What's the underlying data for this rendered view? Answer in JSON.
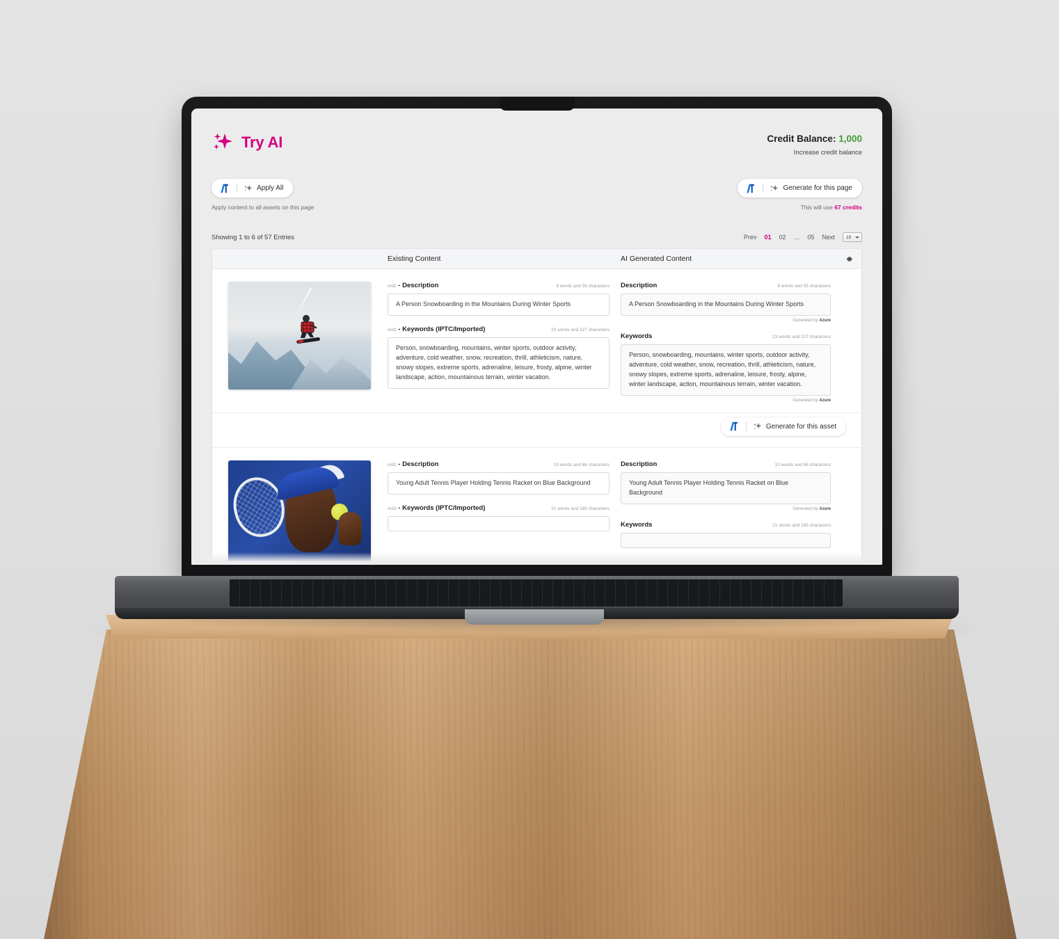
{
  "brand": {
    "title": "Try AI",
    "icon": "sparkle-icon"
  },
  "credit": {
    "label": "Credit Balance:",
    "value": "1,000",
    "link": "Increase credit balance",
    "value_color": "#3f9c35"
  },
  "actions": {
    "apply_all": {
      "label": "Apply All",
      "hint": "Apply content to all assets on this page"
    },
    "generate_page": {
      "label": "Generate for this page",
      "hint_prefix": "This will use ",
      "hint_credits": "67 credits",
      "credits_color": "#d4007f"
    }
  },
  "table_bar": {
    "showing": "Showing 1 to 6 of 57 Entries",
    "pager": {
      "prev": "Prev",
      "pages": [
        "01",
        "02",
        "…",
        "05"
      ],
      "active": "01",
      "next": "Next",
      "per_page": "10"
    }
  },
  "table_header": {
    "existing": "Existing Content",
    "ai": "AI Generated Content",
    "settings_icon": "gear-icon"
  },
  "row_action": {
    "label": "Generate for this asset"
  },
  "generated_note": {
    "prefix": "Generated by ",
    "source": "Azure"
  },
  "rows": [
    {
      "image_alt": "snowboarder-jumping",
      "existing": {
        "description": {
          "namespace": "md2",
          "label": "Description",
          "count": "8 words and 55 characters",
          "value": "A Person Snowboarding in the Mountains During Winter Sports"
        },
        "keywords": {
          "namespace": "md3",
          "label": "Keywords (IPTC/Imported)",
          "count": "23 words and 227 characters",
          "value": "Person, snowboarding, mountains, winter sports, outdoor activity, adventure, cold weather, snow, recreation, thrill, athleticism, nature, snowy slopes, extreme sports, adrenaline, leisure, frosty, alpine, winter landscape, action, mountainous terrain, winter vacation."
        }
      },
      "ai": {
        "description": {
          "label": "Description",
          "count": "8 words and 55 characters",
          "value": "A Person Snowboarding in the Mountains During Winter Sports"
        },
        "keywords": {
          "label": "Keywords",
          "count": "23 words and 227 characters",
          "value": "Person, snowboarding, mountains, winter sports, outdoor activity, adventure, cold weather, snow, recreation, thrill, athleticism, nature, snowy slopes, extreme sports, adrenaline, leisure, frosty, alpine, winter landscape, action, mountainous terrain, winter vacation."
        }
      }
    },
    {
      "image_alt": "tennis-player-with-racket",
      "existing": {
        "description": {
          "namespace": "md2",
          "label": "Description",
          "count": "10 words and 66 characters",
          "value": "Young Adult Tennis Player Holding Tennis Racket on Blue Background"
        },
        "keywords": {
          "namespace": "md3",
          "label": "Keywords (IPTC/Imported)",
          "count": "21 words and 185 characters",
          "value": ""
        }
      },
      "ai": {
        "description": {
          "label": "Description",
          "count": "10 words and 66 characters",
          "value": "Young Adult Tennis Player Holding Tennis Racket on Blue Background"
        },
        "keywords": {
          "label": "Keywords",
          "count": "21 words and 185 characters",
          "value": ""
        }
      }
    }
  ]
}
